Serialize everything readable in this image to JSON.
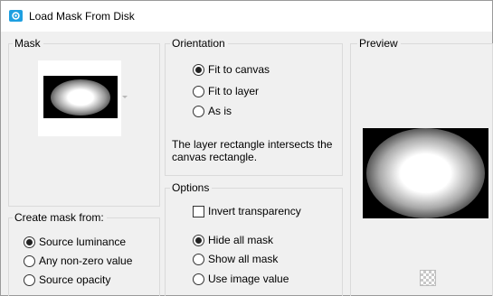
{
  "window": {
    "title": "Load Mask From Disk",
    "title_icon": "paintshop-app-icon"
  },
  "mask_group": {
    "label": "Mask"
  },
  "create_mask": {
    "label": "Create mask from:",
    "options": [
      {
        "label": "Source luminance",
        "checked": true
      },
      {
        "label": "Any non-zero value",
        "checked": false
      },
      {
        "label": "Source opacity",
        "checked": false
      }
    ]
  },
  "orientation": {
    "label": "Orientation",
    "options": [
      {
        "label": "Fit to canvas",
        "checked": true
      },
      {
        "label": "Fit to layer",
        "checked": false
      },
      {
        "label": "As is",
        "checked": false
      }
    ],
    "description": "The layer rectangle intersects the canvas rectangle."
  },
  "options": {
    "label": "Options",
    "invert_label": "Invert transparency",
    "invert_checked": false,
    "radios": [
      {
        "label": "Hide all mask",
        "checked": true
      },
      {
        "label": "Show all mask",
        "checked": false
      },
      {
        "label": "Use image value",
        "checked": false
      }
    ]
  },
  "preview": {
    "label": "Preview",
    "transparency_icon": "checkerboard-icon"
  }
}
